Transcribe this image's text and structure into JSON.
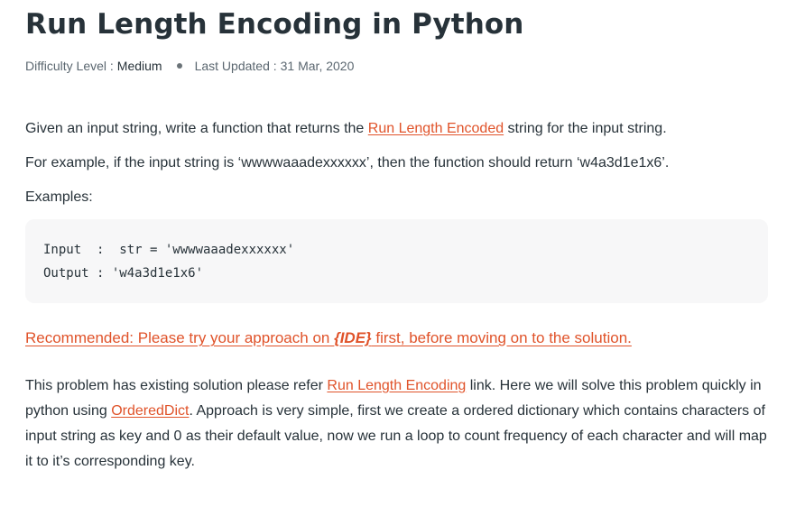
{
  "article": {
    "title": "Run Length Encoding in Python",
    "meta": {
      "difficulty_label": "Difficulty Level :",
      "difficulty_value": "Medium",
      "updated_label": "Last Updated :",
      "updated_value": "31 Mar, 2020"
    },
    "para1": {
      "before": "Given an input string, write a function that returns the ",
      "link": "Run Length Encoded",
      "after": " string for the input string."
    },
    "para2": "For example, if the input string is ‘wwwwaaadexxxxxx’, then the function should return ‘w4a3d1e1x6’.",
    "examples_label": "Examples:",
    "code_lines": [
      "Input  :  str = 'wwwwaaadexxxxxx'",
      "Output : 'w4a3d1e1x6'"
    ],
    "recommended": {
      "before": "Recommended: Please try your approach on ",
      "ide": "{IDE}",
      "after": " first, before moving on to the solution."
    },
    "para3": {
      "t1": "This problem has existing solution please refer ",
      "link1": "Run Length Encoding",
      "t2": " link. Here we will solve this problem quickly in python using ",
      "link2": "OrderedDict",
      "t3": ". Approach is very simple, first we create a ordered dictionary which contains characters of input string as key and 0 as their default value, now we run a loop to count frequency of each character and will map it to it’s corresponding key."
    }
  },
  "colors": {
    "link": "#e0532a",
    "text": "#273239",
    "code_bg": "#f7f7f8"
  }
}
